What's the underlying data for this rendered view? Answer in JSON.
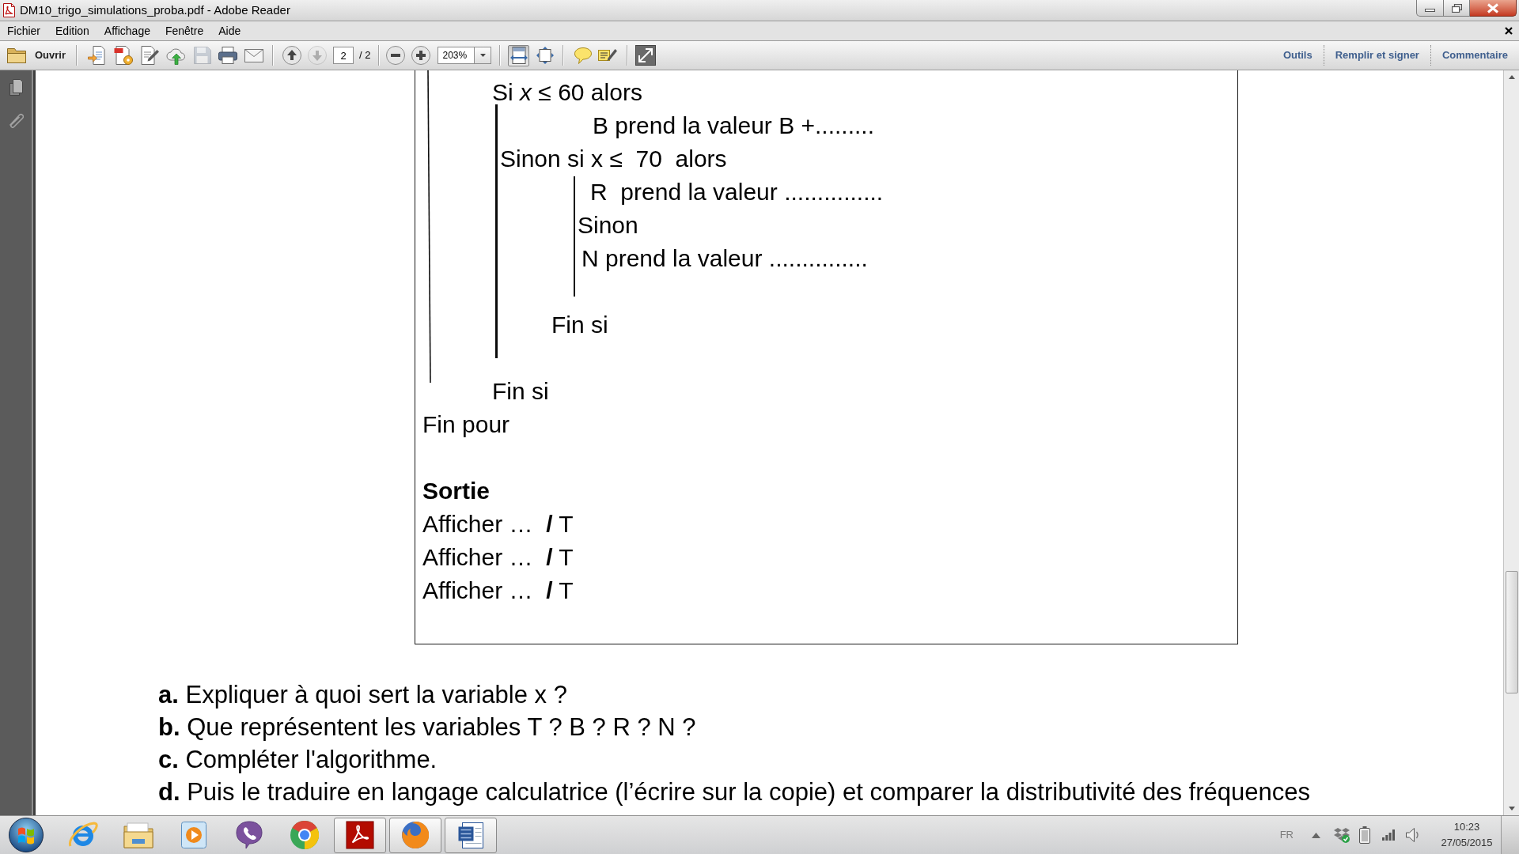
{
  "window": {
    "title": "DM10_trigo_simulations_proba.pdf - Adobe Reader"
  },
  "menu": [
    "Fichier",
    "Edition",
    "Affichage",
    "Fenêtre",
    "Aide"
  ],
  "toolbar": {
    "open_button": "Ouvrir",
    "file_buttons": [
      {
        "disabled": false
      },
      {
        "disabled": false
      },
      {
        "disabled": false
      },
      {
        "disabled": false
      },
      {
        "disabled": true
      },
      {
        "disabled": false
      },
      {
        "disabled": false
      }
    ],
    "page_buttons": [
      {
        "disabled": false
      },
      {
        "disabled": true
      }
    ],
    "page_field": {
      "value": "2"
    },
    "page_count": "/ 2",
    "zoom_field": {
      "value": "203%"
    },
    "view_buttons": [
      {
        "selected": true
      },
      {
        "selected": false
      }
    ],
    "panes": [
      "Outils",
      "Remplir et signer",
      "Commentaire"
    ]
  },
  "document": {
    "algorithm": {
      "body": [
        "Si *x* ≤ 60 alors",
        "B prend la valeur B +.........",
        "Sinon si x ≤  70  alors",
        "R  prend la valeur ...............",
        "Sinon",
        "N prend la valeur ...............",
        "Fin si",
        "Fin si",
        "Fin pour"
      ],
      "output_title": "Sortie",
      "output": [
        "Afficher …  **/** T",
        "Afficher …  **/** T",
        "Afficher …  **/** T"
      ]
    },
    "questions": [
      "**a.** Expliquer à quoi sert la variable x ?",
      "**b.** Que représentent les variables T ? B ? R ? N ?",
      "**c.** Compléter l'algorithme.",
      "**d.** Puis le traduire en langage calculatrice (l’écrire sur la copie) et comparer la distributivité des fréquences"
    ]
  },
  "taskbar": {
    "apps": [
      {
        "running": false
      },
      {
        "running": false
      },
      {
        "running": false
      },
      {
        "running": false
      },
      {
        "running": false
      },
      {
        "running": true
      },
      {
        "running": true
      },
      {
        "running": true
      }
    ],
    "language": "FR",
    "time": "10:23",
    "date": "27/05/2015"
  }
}
